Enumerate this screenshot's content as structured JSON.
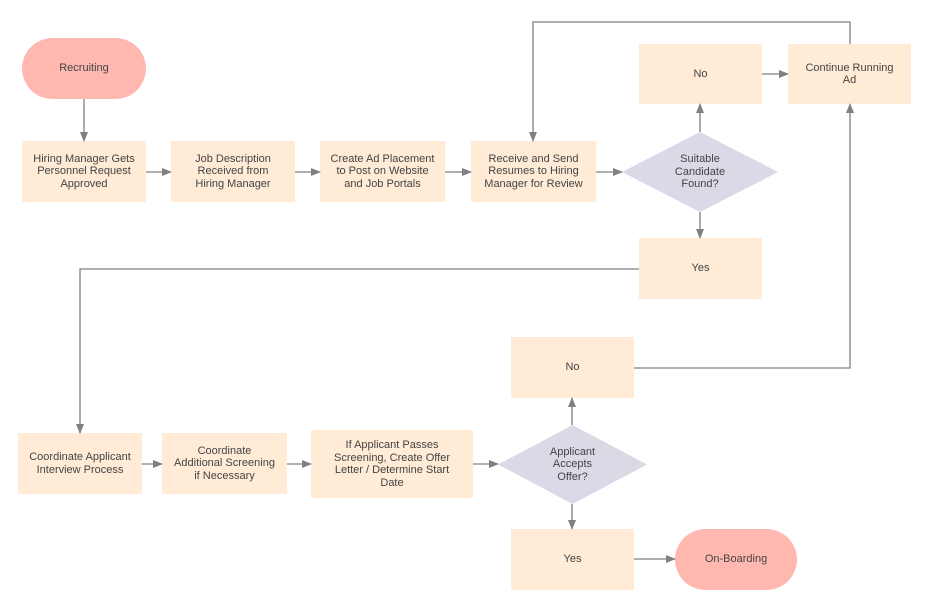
{
  "colors": {
    "terminal": "#ffb8b0",
    "process": "#ffebd6",
    "decision": "#dcd9e7",
    "connector": "#808080",
    "text": "#444444"
  },
  "nodes": {
    "recruiting": {
      "type": "terminal",
      "lines": [
        "Recruiting"
      ]
    },
    "hiring_manager": {
      "type": "process",
      "lines": [
        "Hiring Manager Gets",
        "Personnel Request",
        "Approved"
      ]
    },
    "job_description": {
      "type": "process",
      "lines": [
        "Job Description",
        "Received from",
        "Hiring Manager"
      ]
    },
    "create_ad": {
      "type": "process",
      "lines": [
        "Create Ad Placement",
        "to Post on Website",
        "and Job Portals"
      ]
    },
    "receive_resumes": {
      "type": "process",
      "lines": [
        "Receive and Send",
        "Resumes to Hiring",
        "Manager for Review"
      ]
    },
    "suitable_candidate": {
      "type": "decision",
      "lines": [
        "Suitable",
        "Candidate",
        "Found?"
      ]
    },
    "no_1": {
      "type": "process",
      "lines": [
        "No"
      ]
    },
    "continue_ad": {
      "type": "process",
      "lines": [
        "Continue Running",
        "Ad"
      ]
    },
    "yes_1": {
      "type": "process",
      "lines": [
        "Yes"
      ]
    },
    "coordinate_interview": {
      "type": "process",
      "lines": [
        "Coordinate Applicant",
        "Interview Process"
      ]
    },
    "additional_screening": {
      "type": "process",
      "lines": [
        "Coordinate",
        "Additional Screening",
        "if Necessary"
      ]
    },
    "offer_letter": {
      "type": "process",
      "lines": [
        "If Applicant Passes",
        "Screening, Create Offer",
        "Letter / Determine Start",
        "Date"
      ]
    },
    "applicant_accepts": {
      "type": "decision",
      "lines": [
        "Applicant",
        "Accepts",
        "Offer?"
      ]
    },
    "no_2": {
      "type": "process",
      "lines": [
        "No"
      ]
    },
    "yes_2": {
      "type": "process",
      "lines": [
        "Yes"
      ]
    },
    "onboarding": {
      "type": "terminal",
      "lines": [
        "On-Boarding"
      ]
    }
  }
}
